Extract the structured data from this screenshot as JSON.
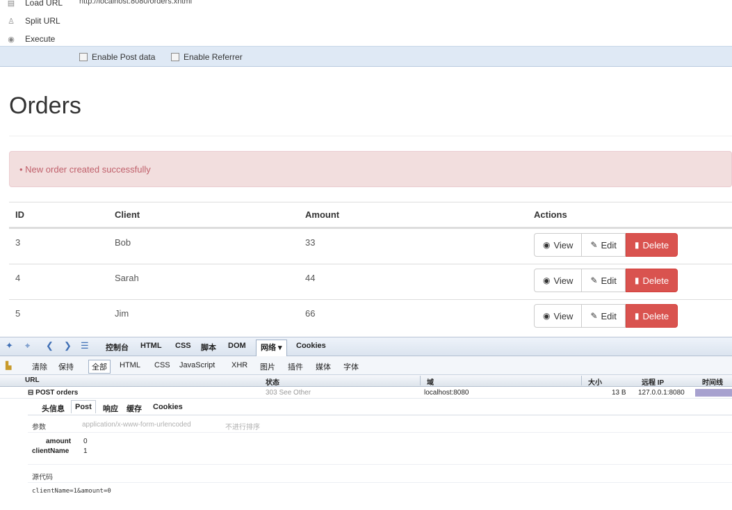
{
  "hackbar": {
    "actions": [
      {
        "label": "Load URL",
        "icon": "load-url-icon"
      },
      {
        "label": "Split URL",
        "icon": "split-url-icon"
      },
      {
        "label": "Execute",
        "icon": "execute-icon"
      }
    ],
    "url": "http://localhost:8080/orders.xhtml",
    "enable_post_label": "Enable Post data",
    "enable_referrer_label": "Enable Referrer"
  },
  "page": {
    "title": "Orders",
    "alert": "• New order created successfully",
    "columns": [
      "ID",
      "Client",
      "Amount",
      "Actions"
    ],
    "rows": [
      {
        "id": "3",
        "client": "Bob",
        "amount": "33"
      },
      {
        "id": "4",
        "client": "Sarah",
        "amount": "44"
      },
      {
        "id": "5",
        "client": "Jim",
        "amount": "66"
      }
    ],
    "buttons": {
      "view": "View",
      "edit": "Edit",
      "delete": "Delete"
    }
  },
  "firebug": {
    "tabs": [
      "控制台",
      "HTML",
      "CSS",
      "脚本",
      "DOM",
      "网络 ▾",
      "Cookies"
    ],
    "active_tab": "网络 ▾",
    "subtabs": [
      "清除",
      "保持",
      "全部",
      "HTML",
      "CSS",
      "JavaScript",
      "XHR",
      "图片",
      "插件",
      "媒体",
      "字体"
    ],
    "active_subtab": "全部",
    "columns": {
      "url": "URL",
      "status": "状态",
      "domain": "域",
      "size": "大小",
      "remote_ip": "远程 IP",
      "timeline": "时间线"
    },
    "request": {
      "url": "⊟ POST orders",
      "status": "303 See Other",
      "domain": "localhost:8080",
      "size": "13 B",
      "remote_ip": "127.0.0.1:8080"
    },
    "detail_tabs": [
      "头信息",
      "Post",
      "响应",
      "缓存",
      "Cookies"
    ],
    "active_detail_tab": "Post",
    "params_label": "参数",
    "content_type": "application/x-www-form-urlencoded",
    "no_sort": "不进行排序",
    "params": [
      {
        "name": "amount",
        "value": "0"
      },
      {
        "name": "clientName",
        "value": "1"
      }
    ],
    "source_label": "源代码",
    "source": "clientName=1&amount=0"
  },
  "colors": {
    "alert_bg": "#f2dede",
    "alert_text": "#c0606b",
    "delete_btn": "#d9534f",
    "hackbar_bar": "#dfe9f5"
  }
}
